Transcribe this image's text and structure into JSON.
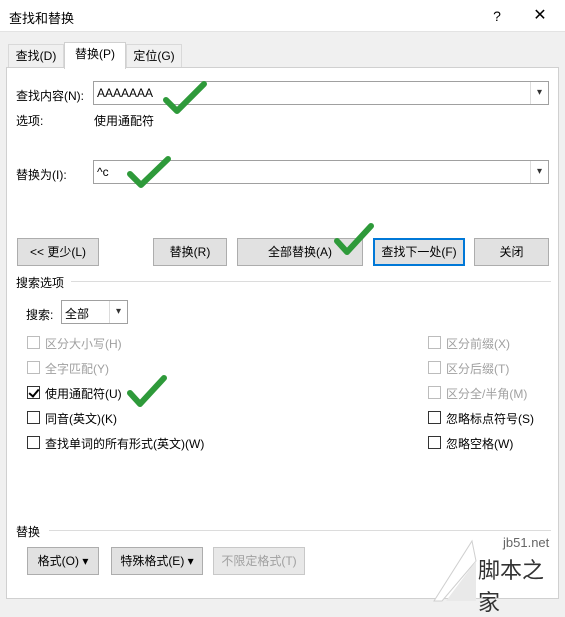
{
  "window": {
    "title": "查找和替换",
    "help_glyph": "?",
    "close_glyph": "✕"
  },
  "tabs": [
    {
      "label": "查找(D)"
    },
    {
      "label": "替换(P)",
      "active": true
    },
    {
      "label": "定位(G)"
    }
  ],
  "find": {
    "label": "查找内容(N):",
    "value": "AAAAAAA",
    "options_label": "选项:",
    "options_value": "使用通配符"
  },
  "replace": {
    "label": "替换为(I):",
    "value": "^c"
  },
  "buttons": {
    "less": "<< 更少(L)",
    "replace": "替换(R)",
    "replace_all": "全部替换(A)",
    "find_next": "查找下一处(F)",
    "close": "关闭"
  },
  "search_options": {
    "group_label": "搜索选项",
    "search_label": "搜索:",
    "search_value": "全部",
    "left_options": [
      {
        "label": "区分大小写(H)",
        "checked": false,
        "disabled": true
      },
      {
        "label": "全字匹配(Y)",
        "checked": false,
        "disabled": true
      },
      {
        "label": "使用通配符(U)",
        "checked": true,
        "disabled": false
      },
      {
        "label": "同音(英文)(K)",
        "checked": false,
        "disabled": false
      },
      {
        "label": "查找单词的所有形式(英文)(W)",
        "checked": false,
        "disabled": false
      }
    ],
    "right_options": [
      {
        "label": "区分前缀(X)",
        "checked": false,
        "disabled": true
      },
      {
        "label": "区分后缀(T)",
        "checked": false,
        "disabled": true
      },
      {
        "label": "区分全/半角(M)",
        "checked": false,
        "disabled": true
      },
      {
        "label": "忽略标点符号(S)",
        "checked": false,
        "disabled": false
      },
      {
        "label": "忽略空格(W)",
        "checked": false,
        "disabled": false
      }
    ]
  },
  "replace_section": {
    "group_label": "替换",
    "format_button": "格式(O) ▾",
    "special_button": "特殊格式(E) ▾",
    "no_format_button": "不限定格式(T)"
  },
  "watermark": {
    "site": "jb51.net",
    "brand": "脚本之家"
  },
  "colors": {
    "accent": "#0078d7",
    "check_green": "#2e9a3a"
  }
}
